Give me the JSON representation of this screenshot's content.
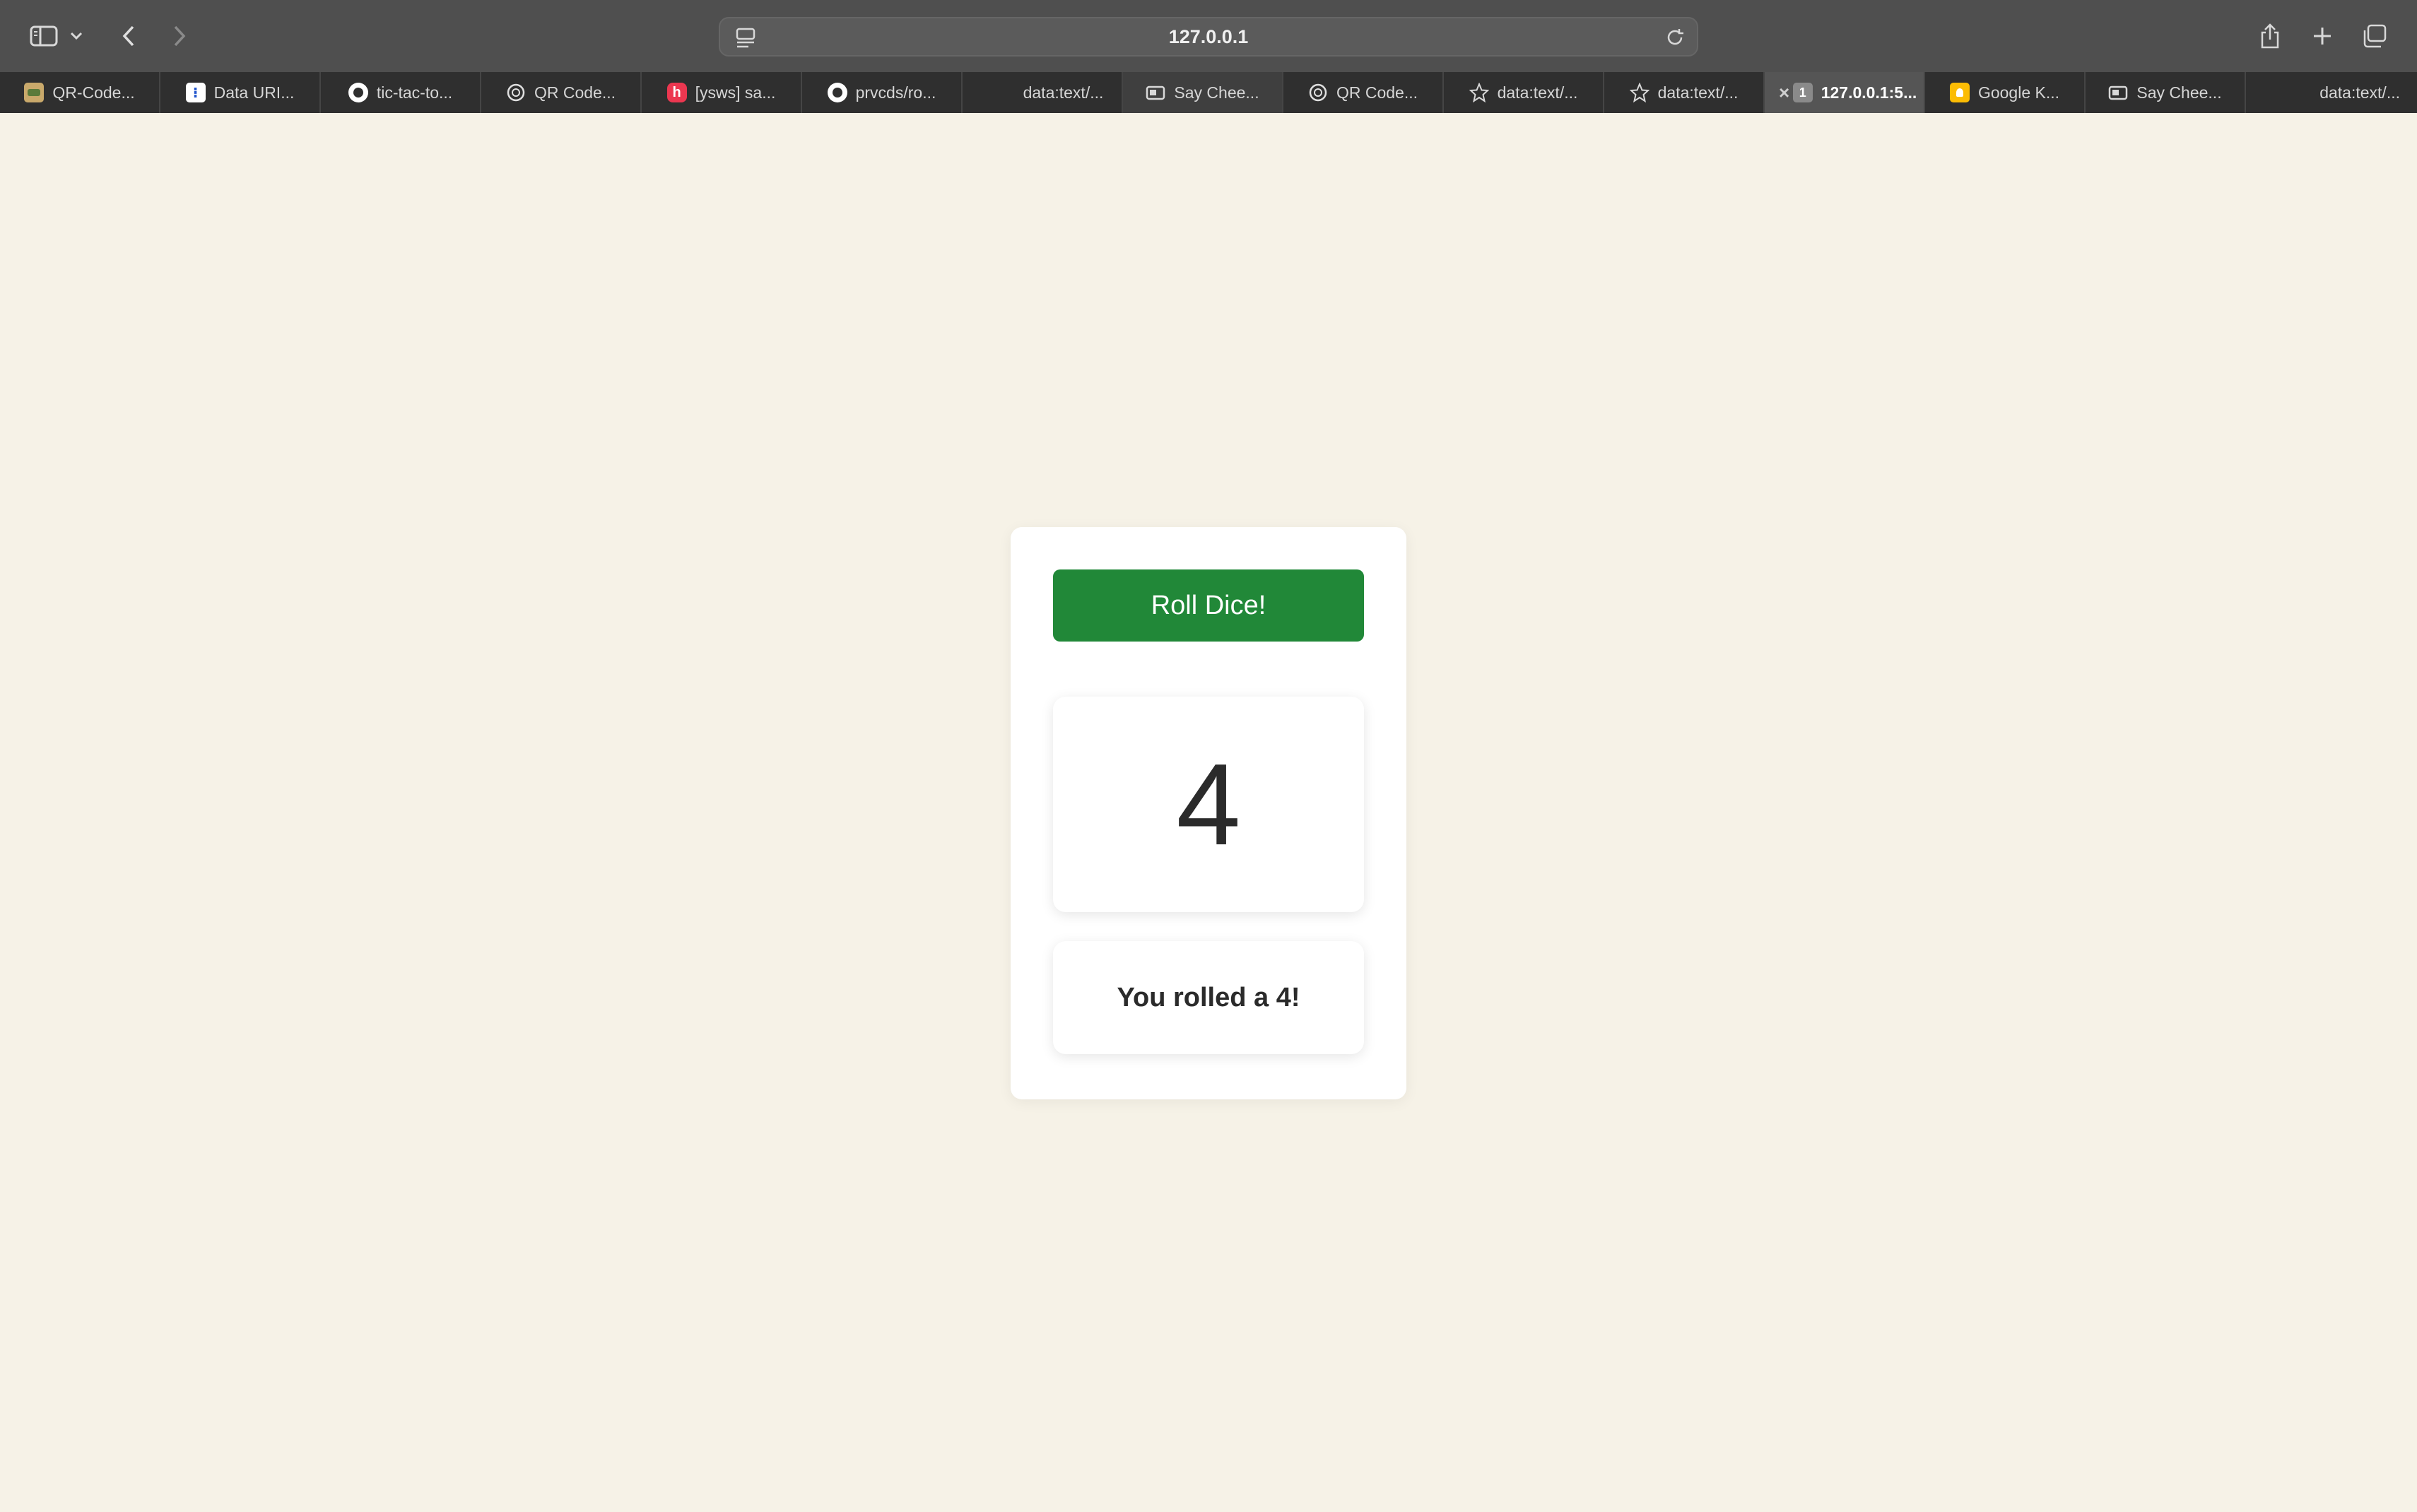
{
  "browser": {
    "address": "127.0.0.1",
    "tabs": [
      {
        "label": "QR-Code...",
        "icon": "qr-code-image-icon"
      },
      {
        "label": "Data URI...",
        "icon": "data-uri-icon"
      },
      {
        "label": "tic-tac-to...",
        "icon": "github-icon"
      },
      {
        "label": "QR Code...",
        "icon": "openai-icon"
      },
      {
        "label": "[ysws] sa...",
        "icon": "hackclub-icon"
      },
      {
        "label": "prvcds/ro...",
        "icon": "github-icon"
      },
      {
        "label": "data:text/...",
        "icon": ""
      },
      {
        "label": "Say Chee...",
        "icon": "camera-icon"
      },
      {
        "label": "QR Code...",
        "icon": "openai-icon"
      },
      {
        "label": "data:text/...",
        "icon": "star-icon"
      },
      {
        "label": "data:text/...",
        "icon": "star-icon"
      },
      {
        "label": "127.0.0.1:5...",
        "icon": "number-one-icon",
        "badge": "1",
        "active": true
      },
      {
        "label": "Google K...",
        "icon": "google-keep-icon"
      },
      {
        "label": "Say Chee...",
        "icon": "camera-icon"
      },
      {
        "label": "data:text/...",
        "icon": ""
      }
    ]
  },
  "app": {
    "roll_button_label": "Roll Dice!",
    "die_value": "4",
    "result_text": "You rolled a 4!"
  },
  "colors": {
    "page_background": "#f6f2e7",
    "roll_button": "#218838"
  }
}
